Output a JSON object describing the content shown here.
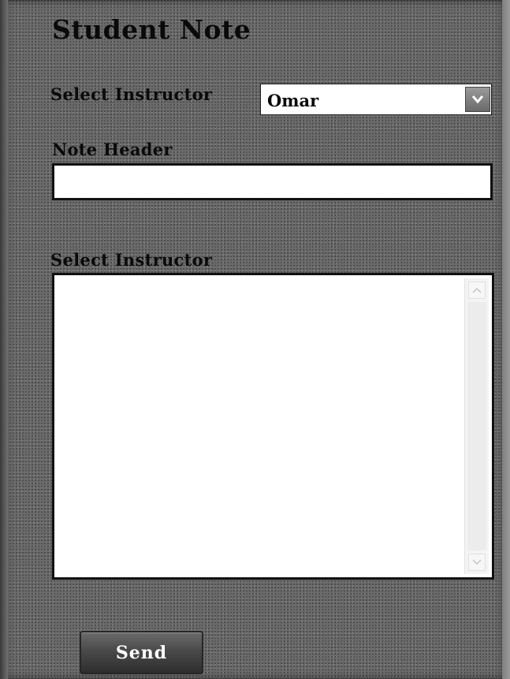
{
  "form": {
    "title": "Student Note",
    "instructor_label": "Select Instructor",
    "instructor_selected": "Omar",
    "note_header_label": "Note Header",
    "note_header_value": "",
    "note_body_label": "Select Instructor",
    "note_body_value": "",
    "send_label": "Send"
  },
  "icons": {
    "dropdown": "chevron-down-icon",
    "scroll_up": "chevron-up-icon",
    "scroll_down": "chevron-down-icon"
  },
  "colors": {
    "panel_background": "#6d6d6d",
    "field_background": "#ffffff",
    "button_background": "#3c3c3c",
    "button_text": "#ffffff"
  }
}
